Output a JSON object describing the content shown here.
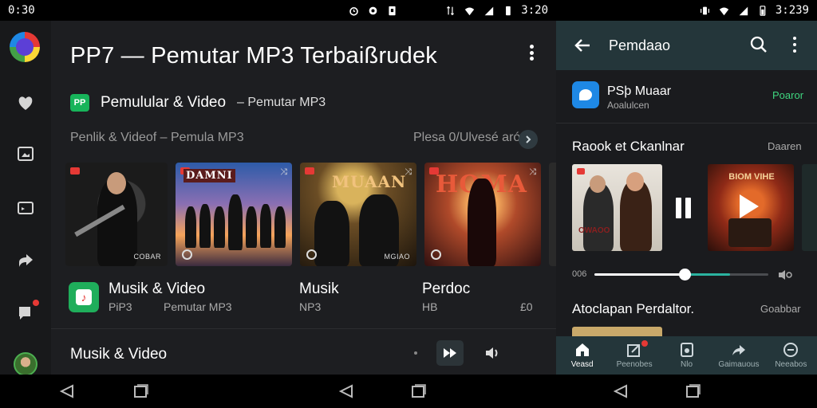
{
  "status_left": {
    "time": "0:30"
  },
  "status_right": {
    "time": "3:239"
  },
  "status_mid": {
    "time": "3:20"
  },
  "main": {
    "title": "PP7 — Pemutar MP3 Terbaißrudek",
    "section_title": "Pemulular & Video",
    "section_sub": "– Pemutar MP3",
    "section_icon_text": "PP",
    "row_label": "Penlik & Videof – Pemula MP3",
    "row_right": "Plesa 0/Ulvesé aró",
    "cards": [
      {
        "tag": "COBAR"
      },
      {
        "cover": "DAMNI",
        "tag": ""
      },
      {
        "cover": "MUAAN",
        "tag": "MGIAO"
      },
      {
        "cover": "HOMA",
        "tag": ""
      }
    ],
    "items": [
      {
        "title": "Musik & Video",
        "sub": "PiP3"
      },
      {
        "title": "",
        "sub": "Pemutar MP3"
      },
      {
        "title": "Musik",
        "sub": "NP3"
      },
      {
        "title": "Perdoc",
        "sub": "HB"
      }
    ],
    "items_tail": "£0",
    "bottom_label": "Musik & Video"
  },
  "right": {
    "toolbar_title": "Pemdaao",
    "app_title": "PSþ Muaar",
    "app_sub": "Aoalulcen",
    "app_action": "Poaror",
    "section_title": "Raook et Ckanlnar",
    "section_right": "Daaren",
    "card1_cover": "OWAOO",
    "card2_cover": "BIOM VIHE",
    "seek_time": "006",
    "seek_progress": 0.52,
    "seek_buffer": 0.78,
    "section2_title": "Atoclapan Perdaltor.",
    "section2_right": "Goabbar",
    "bottom_nav": [
      {
        "label": "Veasd",
        "icon": "home-icon",
        "active": true
      },
      {
        "label": "Peenobes",
        "icon": "edit-badge-icon",
        "active": false
      },
      {
        "label": "Nlo",
        "icon": "music-box-icon",
        "active": false
      },
      {
        "label": "Gaimauous",
        "icon": "share-icon",
        "active": false
      },
      {
        "label": "Neeabos",
        "icon": "minus-circle-icon",
        "active": false
      }
    ]
  },
  "colors": {
    "accent_green": "#1fae5b",
    "toolbar_teal": "#24363a",
    "seek_buffer": "#2bb3a0",
    "bg_dark": "#1d1e21"
  }
}
